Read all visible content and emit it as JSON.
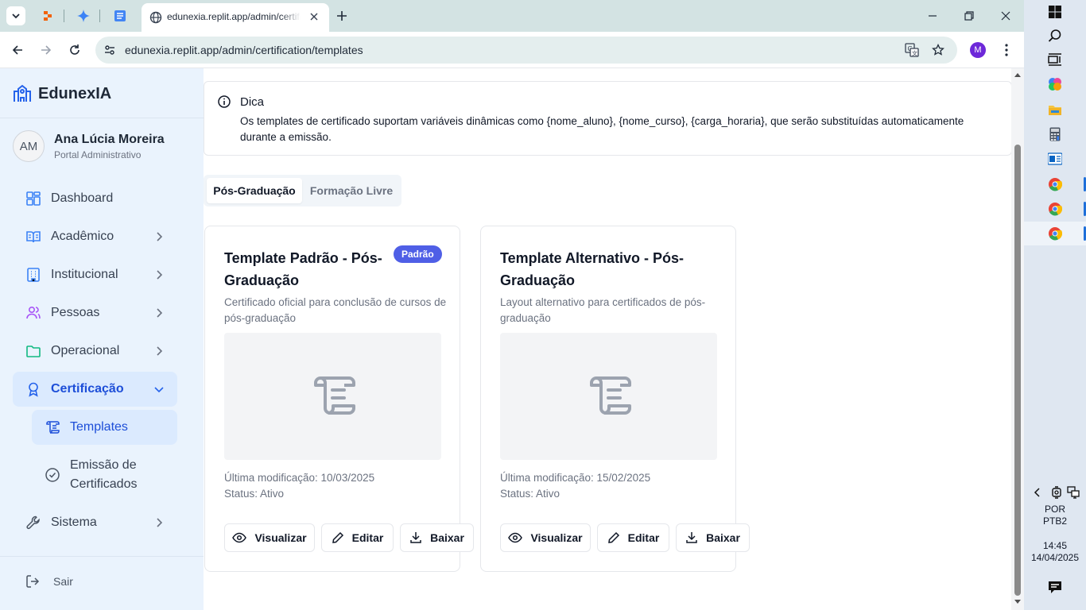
{
  "browser": {
    "tab_title": "edunexia.replit.app/admin/certification/templates",
    "url": "edunexia.replit.app/admin/certification/templates",
    "profile_initial": "M"
  },
  "sidebar": {
    "brand": "EdunexIA",
    "user": {
      "initials": "AM",
      "name": "Ana Lúcia Moreira",
      "role": "Portal Administrativo"
    },
    "items": [
      {
        "label": "Dashboard",
        "icon": "dashboard-grid-icon"
      },
      {
        "label": "Acadêmico",
        "icon": "book-open-icon"
      },
      {
        "label": "Institucional",
        "icon": "building-icon"
      },
      {
        "label": "Pessoas",
        "icon": "users-icon"
      },
      {
        "label": "Operacional",
        "icon": "folder-icon"
      },
      {
        "label": "Certificação",
        "icon": "award-icon",
        "active": true
      },
      {
        "label": "Sistema",
        "icon": "wrench-icon"
      }
    ],
    "subitems": [
      {
        "label": "Templates",
        "icon": "scroll-icon",
        "active": true
      },
      {
        "label": "Emissão de Certificados",
        "icon": "check-circle-icon"
      }
    ],
    "logout_label": "Sair"
  },
  "tip": {
    "title": "Dica",
    "text": "Os templates de certificado suportam variáveis dinâmicas como {nome_aluno}, {nome_curso}, {carga_horaria}, que serão substituídas automaticamente durante a emissão."
  },
  "tabs": [
    {
      "label": "Pós-Graduação",
      "active": true
    },
    {
      "label": "Formação Livre",
      "active": false
    }
  ],
  "cards": [
    {
      "title": "Template Padrão - Pós-Graduação",
      "badge": "Padrão",
      "description": "Certificado oficial para conclusão de cursos de pós-graduação",
      "modified": "Última modificação: 10/03/2025",
      "status": "Status: Ativo",
      "buttons": {
        "view": "Visualizar",
        "edit": "Editar",
        "download": "Baixar"
      }
    },
    {
      "title": "Template Alternativo - Pós-Graduação",
      "description": "Layout alternativo para certificados de pós-graduação",
      "modified": "Última modificação: 15/02/2025",
      "status": "Status: Ativo",
      "buttons": {
        "view": "Visualizar",
        "edit": "Editar",
        "download": "Baixar"
      }
    }
  ],
  "taskbar": {
    "lang_line1": "POR",
    "lang_line2": "PTB2",
    "time": "14:45",
    "date": "14/04/2025"
  },
  "colors": {
    "accent": "#1d4ed8",
    "sidebar_bg": "#eaf3fd",
    "badge": "#4f5fe6",
    "tabbar": "#d3e3e3"
  }
}
